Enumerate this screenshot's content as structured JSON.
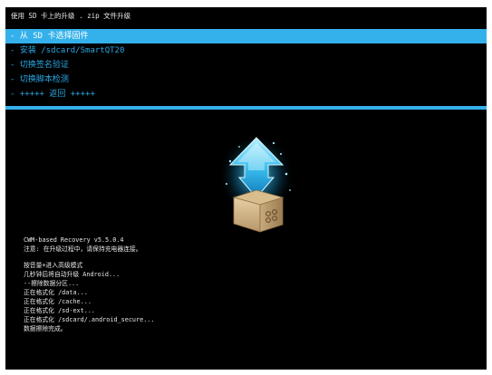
{
  "header": {
    "title": "使用 SD 卡上的升级 . zip 文件升级"
  },
  "menu": {
    "items": [
      {
        "label": "- 从 SD 卡选择固件",
        "selected": true
      },
      {
        "label": "- 安装 /sdcard/SmartQT20",
        "selected": false
      },
      {
        "label": "- 切换签名验证",
        "selected": false
      },
      {
        "label": "- 切换脚本检测",
        "selected": false
      },
      {
        "label": "- +++++ 返回 +++++",
        "selected": false
      }
    ]
  },
  "colors": {
    "accent": "#34b0ea",
    "menu_text": "#29a8e3",
    "background": "#000000",
    "log_text": "#e6e6e6"
  },
  "logo": {
    "icon": "install-package-icon"
  },
  "log": {
    "lines": [
      "CWM-based Recovery v5.5.0.4",
      "注意: 在升级过程中，请保持充电器连接。",
      "",
      "按音量+进入高级模式",
      "几秒钟后将自动升级 Android...",
      "--擦除数据分区...",
      "正在格式化 /data...",
      "正在格式化 /cache...",
      "正在格式化 /sd-ext...",
      "正在格式化 /sdcard/.android_secure...",
      "数据擦除完成。"
    ]
  }
}
